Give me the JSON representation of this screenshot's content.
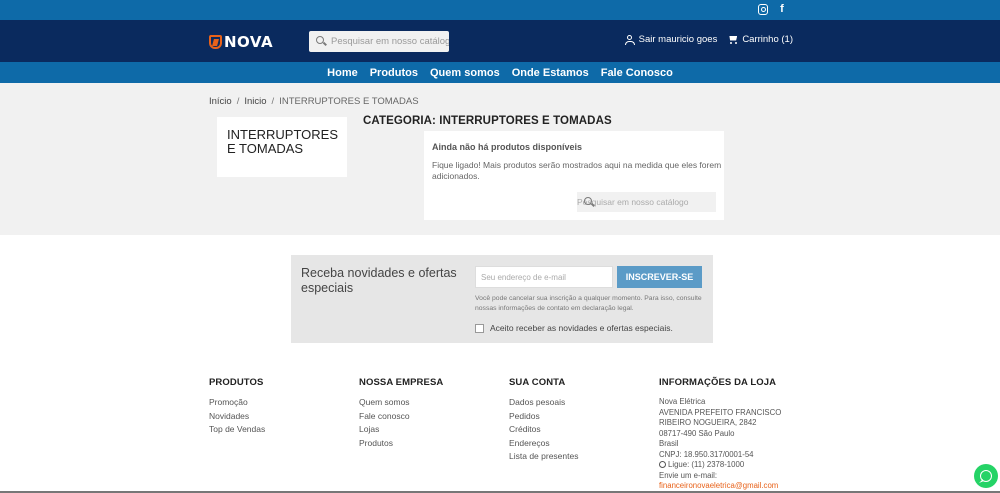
{
  "topbar": {
    "icons": [
      "instagram-icon",
      "facebook-icon"
    ]
  },
  "header": {
    "logo_text": "NOVA",
    "search_placeholder": "Pesquisar em nosso catálogo",
    "user_label": "Sair mauricio goes",
    "cart_label": "Carrinho (1)"
  },
  "nav": {
    "items": [
      {
        "label": "Home"
      },
      {
        "label": "Produtos"
      },
      {
        "label": "Quem somos"
      },
      {
        "label": "Onde Estamos"
      },
      {
        "label": "Fale Conosco"
      }
    ]
  },
  "breadcrumb": {
    "items": [
      "Início",
      "Inicio",
      "INTERRUPTORES E TOMADAS"
    ],
    "separator": "/"
  },
  "category": {
    "sidebar_title": "INTERRUPTORES E TOMADAS",
    "page_title": "CATEGORIA: INTERRUPTORES E TOMADAS",
    "empty_heading": "Ainda não há produtos disponíveis",
    "empty_text": "Fique ligado! Mais produtos serão mostrados aqui na medida que eles forem adicionados.",
    "search_placeholder": "Pesquisar em nosso catálogo"
  },
  "newsletter": {
    "lead": "Receba novidades e ofertas especiais",
    "email_placeholder": "Seu endereço de e-mail",
    "button": "INSCREVER-SE",
    "legal": "Você pode cancelar sua inscrição a qualquer momento. Para isso, consulte nossas informações de contato em declaração legal.",
    "consent": "Aceito receber as novidades e ofertas especiais."
  },
  "footer": {
    "products": {
      "title": "PRODUTOS",
      "links": [
        "Promoção",
        "Novidades",
        "Top de Vendas"
      ]
    },
    "company": {
      "title": "NOSSA EMPRESA",
      "links": [
        "Quem somos",
        "Fale conosco",
        "Lojas",
        "Produtos"
      ]
    },
    "account": {
      "title": "SUA CONTA",
      "links": [
        "Dados pesoais",
        "Pedidos",
        "Créditos",
        "Endereços",
        "Lista de presentes"
      ]
    },
    "store": {
      "title": "INFORMAÇÕES DA LOJA",
      "name": "Nova Elétrica",
      "address1": "AVENIDA PREFEITO FRANCISCO",
      "address2": "RIBEIRO NOGUEIRA, 2842",
      "address3": "08717-490 São Paulo",
      "country": "Brasil",
      "cnpj": "CNPJ: 18.950.317/0001-54",
      "phone": "Ligue: (11) 2378-1000",
      "email_label": "Envie um e-mail:",
      "email": "financeironovaeletrica@gmail.com"
    }
  },
  "colors": {
    "topbar": "#0e6aa8",
    "header": "#0a2a5e",
    "accent": "#e8621a",
    "button": "#5b9bc7",
    "whatsapp": "#25d366"
  }
}
